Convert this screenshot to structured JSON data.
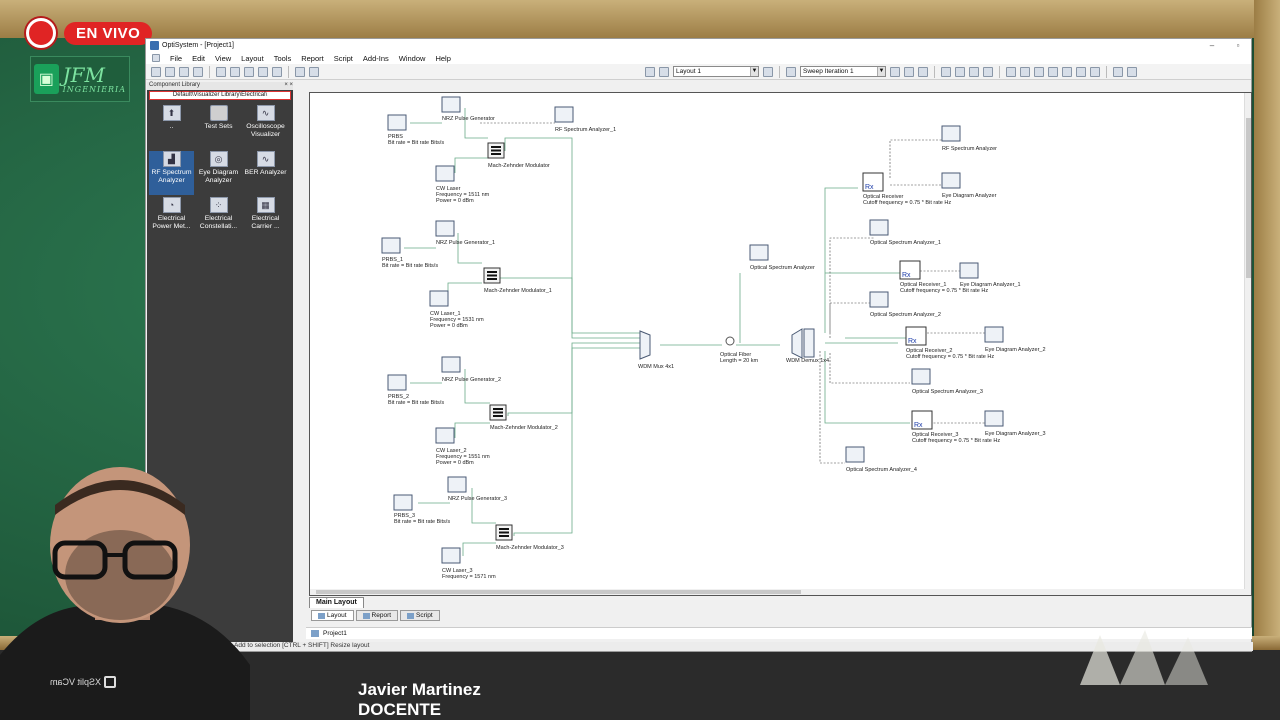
{
  "stream": {
    "live_label": "EN VIVO"
  },
  "logo": {
    "main": "JFM",
    "sub": "INGENIERIA"
  },
  "window": {
    "title": "OptiSystem - [Project1]",
    "minimize": "–",
    "maximize": "▫"
  },
  "menu": [
    "File",
    "Edit",
    "View",
    "Layout",
    "Tools",
    "Report",
    "Script",
    "Add-Ins",
    "Window",
    "Help"
  ],
  "toolbar": {
    "layout_combo": "Layout 1",
    "sweep_combo": "Sweep Iteration 1"
  },
  "library": {
    "header": "Component Library",
    "close": "× ×",
    "path": "Default\\Visualizer Library\\Electrical\\",
    "items": [
      {
        "label": "..",
        "icon": "up-arrow-icon",
        "glyph": "⬆"
      },
      {
        "label": "Test Sets",
        "icon": "folder-icon",
        "glyph": ""
      },
      {
        "label": "Oscilloscope Visualizer",
        "icon": "oscilloscope-icon",
        "glyph": "∿"
      },
      {
        "label": "RF Spectrum Analyzer",
        "icon": "rf-spectrum-icon",
        "glyph": "▟",
        "selected": true
      },
      {
        "label": "Eye Diagram Analyzer",
        "icon": "eye-diagram-icon",
        "glyph": "◎"
      },
      {
        "label": "BER Analyzer",
        "icon": "ber-icon",
        "glyph": "∿"
      },
      {
        "label": "Electrical Power Met...",
        "icon": "power-meter-icon",
        "glyph": "◔"
      },
      {
        "label": "Electrical Constellati...",
        "icon": "constellation-icon",
        "glyph": "⁘"
      },
      {
        "label": "Electrical Carrier ...",
        "icon": "carrier-icon",
        "glyph": "▦"
      }
    ]
  },
  "diagram": {
    "prbs": [
      "PRBS",
      "PRBS_1",
      "PRBS_2",
      "PRBS_3"
    ],
    "prbs_param": "Bit rate = Bit rate  Bits/s",
    "nrz": [
      "NRZ Pulse Generator",
      "NRZ Pulse Generator_1",
      "NRZ Pulse Generator_2",
      "NRZ Pulse Generator_3"
    ],
    "mzm": [
      "Mach-Zehnder Modulator",
      "Mach-Zehnder Modulator_1",
      "Mach-Zehnder Modulator_2",
      "Mach-Zehnder Modulator_3"
    ],
    "cw": [
      "CW Laser",
      "CW Laser_1",
      "CW Laser_2",
      "CW Laser_3"
    ],
    "cw_freq": [
      "Frequency = 1511  nm",
      "Frequency = 1531  nm",
      "Frequency = 1551  nm",
      "Frequency = 1571  nm"
    ],
    "cw_power": "Power = 0  dBm",
    "rf_analyzer_1": "RF Spectrum Analyzer_1",
    "mux": "WDM Mux 4x1",
    "fiber": "Optical Fiber",
    "fiber_len": "Length = 20  km",
    "demux": "WDM Demux 1x4",
    "osa_center": "Optical Spectrum Analyzer",
    "rf_analyzer": "RF Spectrum Analyzer",
    "receivers": [
      "Optical Receiver",
      "Optical Receiver_1",
      "Optical Receiver_2",
      "Optical Receiver_3"
    ],
    "rx_cut": [
      "Cutoff frequency = 0.75 * Bit rate  Hz",
      "Cutoff frequency = 0.75 * Bit rate  Hz",
      "Cutoff frequency = 0.75 * Bit rate  Hz",
      "Cutoff frequency = 0.75 * Bit rate  Hz"
    ],
    "eye": [
      "Eye Diagram Analyzer",
      "Eye Diagram Analyzer_1",
      "Eye Diagram Analyzer_2",
      "Eye Diagram Analyzer_3"
    ],
    "osa": [
      "Optical Spectrum Analyzer_1",
      "Optical Spectrum Analyzer_2",
      "Optical Spectrum Analyzer_3",
      "Optical Spectrum Analyzer_4"
    ]
  },
  "tabs": {
    "main_layout": "Main Layout",
    "layout": "Layout",
    "report": "Report",
    "script": "Script",
    "project": "Project1"
  },
  "status": "plicate  [SHIFT] : Add to selection  [CTRL + SHIFT] Resize layout",
  "camera": {
    "label": "XSplit VCam"
  },
  "presenter": {
    "name": "Javier Martinez",
    "role": "DOCENTE"
  }
}
